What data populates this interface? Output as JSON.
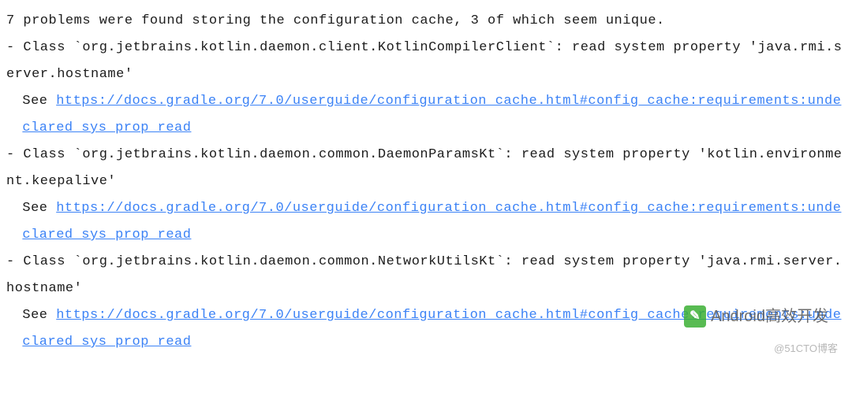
{
  "summary": "7 problems were found storing the configuration cache, 3 of which seem unique.",
  "problems": [
    {
      "prefix": "- Class `",
      "class": "org.jetbrains.kotlin.daemon.client.KotlinCompilerClient",
      "suffix": "`: read system property '",
      "property": "java.rmi.server.hostname",
      "end": "'",
      "see_label": "See ",
      "see_url": "https://docs.gradle.org/7.0/userguide/configuration_cache.html#config_cache:requirements:undeclared_sys_prop_read"
    },
    {
      "prefix": "- Class `",
      "class": "org.jetbrains.kotlin.daemon.common.DaemonParamsKt",
      "suffix": "`: read system property '",
      "property": "kotlin.environment.keepalive",
      "end": "'",
      "see_label": "See ",
      "see_url": "https://docs.gradle.org/7.0/userguide/configuration_cache.html#config_cache:requirements:undeclared_sys_prop_read"
    },
    {
      "prefix": "- Class `",
      "class": "org.jetbrains.kotlin.daemon.common.NetworkUtilsKt",
      "suffix": "`: read system property '",
      "property": "java.rmi.server.hostname",
      "end": "'",
      "see_label": "See ",
      "see_url": "https://docs.gradle.org/7.0/userguide/configuration_cache.html#config_cache:requirements:undeclared_sys_prop_read"
    }
  ],
  "watermark": {
    "icon_glyph": "✎",
    "text": "Android高效开发"
  },
  "footer": "@51CTO博客"
}
